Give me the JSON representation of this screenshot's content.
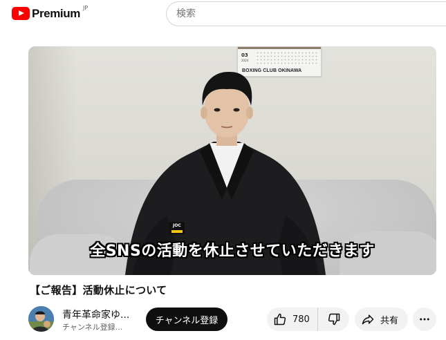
{
  "header": {
    "logo_word": "Premium",
    "logo_region": "JP",
    "search_placeholder": "検索"
  },
  "video": {
    "calendar_month": "03",
    "calendar_sub": "2024",
    "calendar_brand": "BOXING CLUB OKINAWA",
    "badge_text": "JOC",
    "subtitle": "全SNSの活動を休止させていただきます"
  },
  "title": "【ご報告】活動休止について",
  "channel": {
    "name": "青年革命家ゆ...",
    "subs": "チャンネル登録...",
    "subscribe_label": "チャンネル登録"
  },
  "actions": {
    "like_count": "780",
    "share_label": "共有"
  },
  "colors": {
    "brand_red": "#ff0000",
    "subscribe_bg": "#0f0f0f",
    "pill_bg": "#f2f2f2"
  },
  "icons": {
    "logo": "youtube-logo-icon",
    "like": "thumbs-up-icon",
    "dislike": "thumbs-down-icon",
    "share": "share-arrow-icon",
    "more": "more-horizontal-icon"
  }
}
